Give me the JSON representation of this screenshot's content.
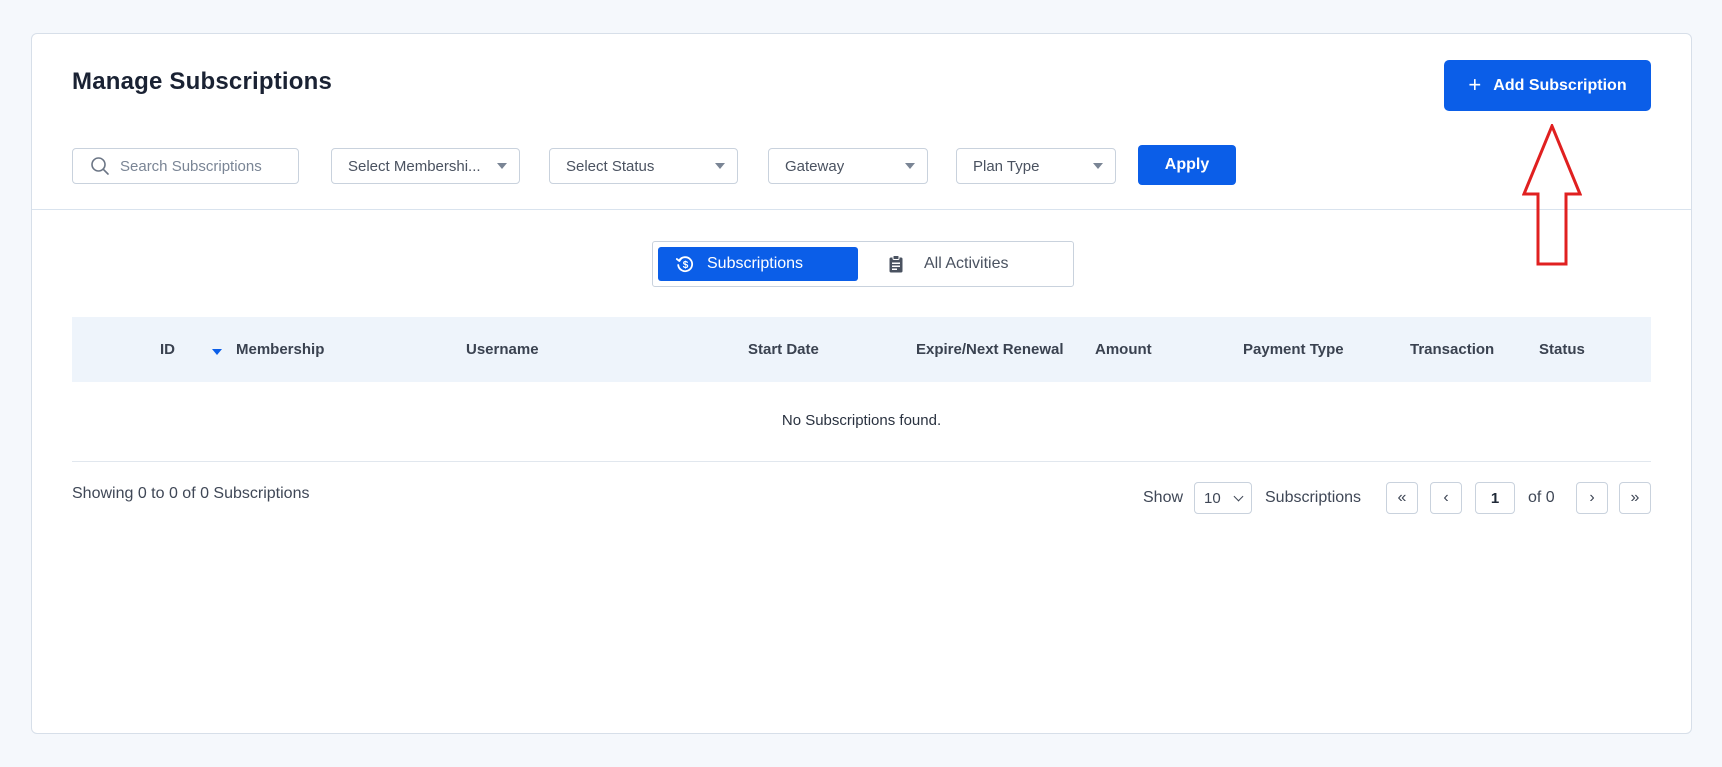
{
  "header": {
    "title": "Manage Subscriptions",
    "add_button_icon": "plus-icon",
    "add_button_label": "Add Subscription"
  },
  "filters": {
    "search_placeholder": "Search Subscriptions",
    "membership_select": "Select Membershi...",
    "status_select": "Select Status",
    "gateway_select": "Gateway",
    "plan_type_select": "Plan Type",
    "apply_label": "Apply"
  },
  "tabs": [
    {
      "label": "Subscriptions",
      "icon": "subscription-cycle-icon",
      "active": true
    },
    {
      "label": "All Activities",
      "icon": "clipboard-icon",
      "active": false
    }
  ],
  "table": {
    "columns": [
      "ID",
      "Membership",
      "Username",
      "Start Date",
      "Expire/Next Renewal",
      "Amount",
      "Payment Type",
      "Transaction",
      "Status"
    ],
    "sorted_column": "ID",
    "empty_message": "No Subscriptions found."
  },
  "footer": {
    "showing": "Showing 0 to 0 of 0 Subscriptions",
    "show_label": "Show",
    "per_page": "10",
    "per_page_suffix": "Subscriptions",
    "first_label": "«",
    "prev_label": "‹",
    "current_page": "1",
    "of_pages": "of 0",
    "next_label": "›",
    "last_label": "»"
  },
  "colors": {
    "accent": "#0b5ee8",
    "annotation": "#e02020",
    "table_header_bg": "#eef4fb",
    "page_bg": "#f5f8fc"
  }
}
